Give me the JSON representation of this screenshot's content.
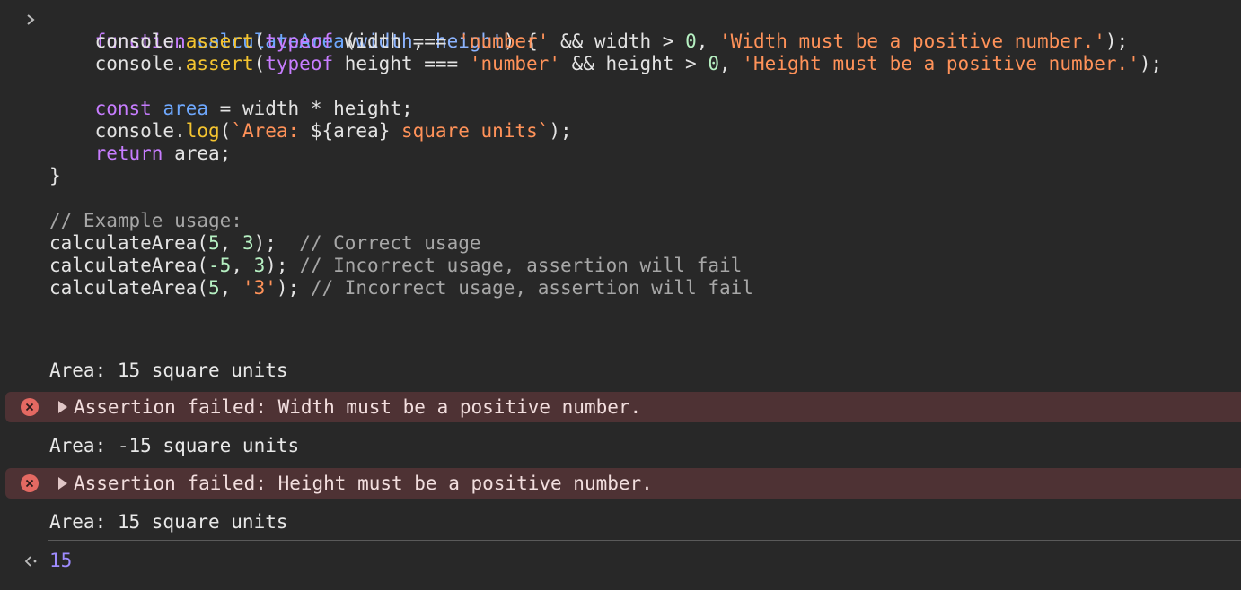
{
  "code": {
    "l1": {
      "kw": "function",
      "name": "calculateArea",
      "p1": "width",
      "sep": ", ",
      "p2": "height",
      "tail": ") {"
    },
    "l2": {
      "a": "console.",
      "b": "assert",
      "c": "(",
      "d": "typeof",
      "e": " width === ",
      "f": "'number'",
      "g": " && width > ",
      "h": "0",
      "i": ", ",
      "j": "'Width must be a positive number.'",
      "k": ");"
    },
    "l3": {
      "a": "console.",
      "b": "assert",
      "c": "(",
      "d": "typeof",
      "e": " height === ",
      "f": "'number'",
      "g": " && height > ",
      "h": "0",
      "i": ", ",
      "j": "'Height must be a positive number.'",
      "k": ");"
    },
    "l5": {
      "kw": "const",
      "var": "area",
      "rest": " = width * height;"
    },
    "l6": {
      "a": "console.",
      "b": "log",
      "c": "(",
      "d": "`Area: ",
      "e": "${area}",
      "f": " square units`",
      "g": ");"
    },
    "l7": {
      "kw": "return",
      "rest": " area;"
    },
    "l8": "}",
    "l10": "// Example usage:",
    "l11": {
      "a": "calculateArea(",
      "b": "5",
      "c": ", ",
      "d": "3",
      "e": ");  ",
      "f": "// Correct usage"
    },
    "l12": {
      "a": "calculateArea(",
      "b": "-5",
      "c": ", ",
      "d": "3",
      "e": "); ",
      "f": "// Incorrect usage, assertion will fail"
    },
    "l13": {
      "a": "calculateArea(",
      "b": "5",
      "c": ", ",
      "d": "'3'",
      "e": "); ",
      "f": "// Incorrect usage, assertion will fail"
    }
  },
  "output": {
    "log1": "Area: 15 square units",
    "error1": "Assertion failed: Width must be a positive number.",
    "log2": "Area: -15 square units",
    "error2": "Assertion failed: Height must be a positive number.",
    "log3": "Area: 15 square units",
    "result": "15"
  },
  "icons": {
    "prompt": "chevron-right-icon",
    "error": "error-circle-icon",
    "expand": "expand-triangle-icon",
    "result": "return-arrow-icon"
  },
  "colors": {
    "background": "#282828",
    "keyword": "#c77dff",
    "function_name": "#6ea8fe",
    "string": "#ff9259",
    "number": "#b6f0c2",
    "comment": "#a7a7a7",
    "error_background": "#4e3234",
    "error_icon": "#e46962",
    "result": "#9f8cff"
  }
}
